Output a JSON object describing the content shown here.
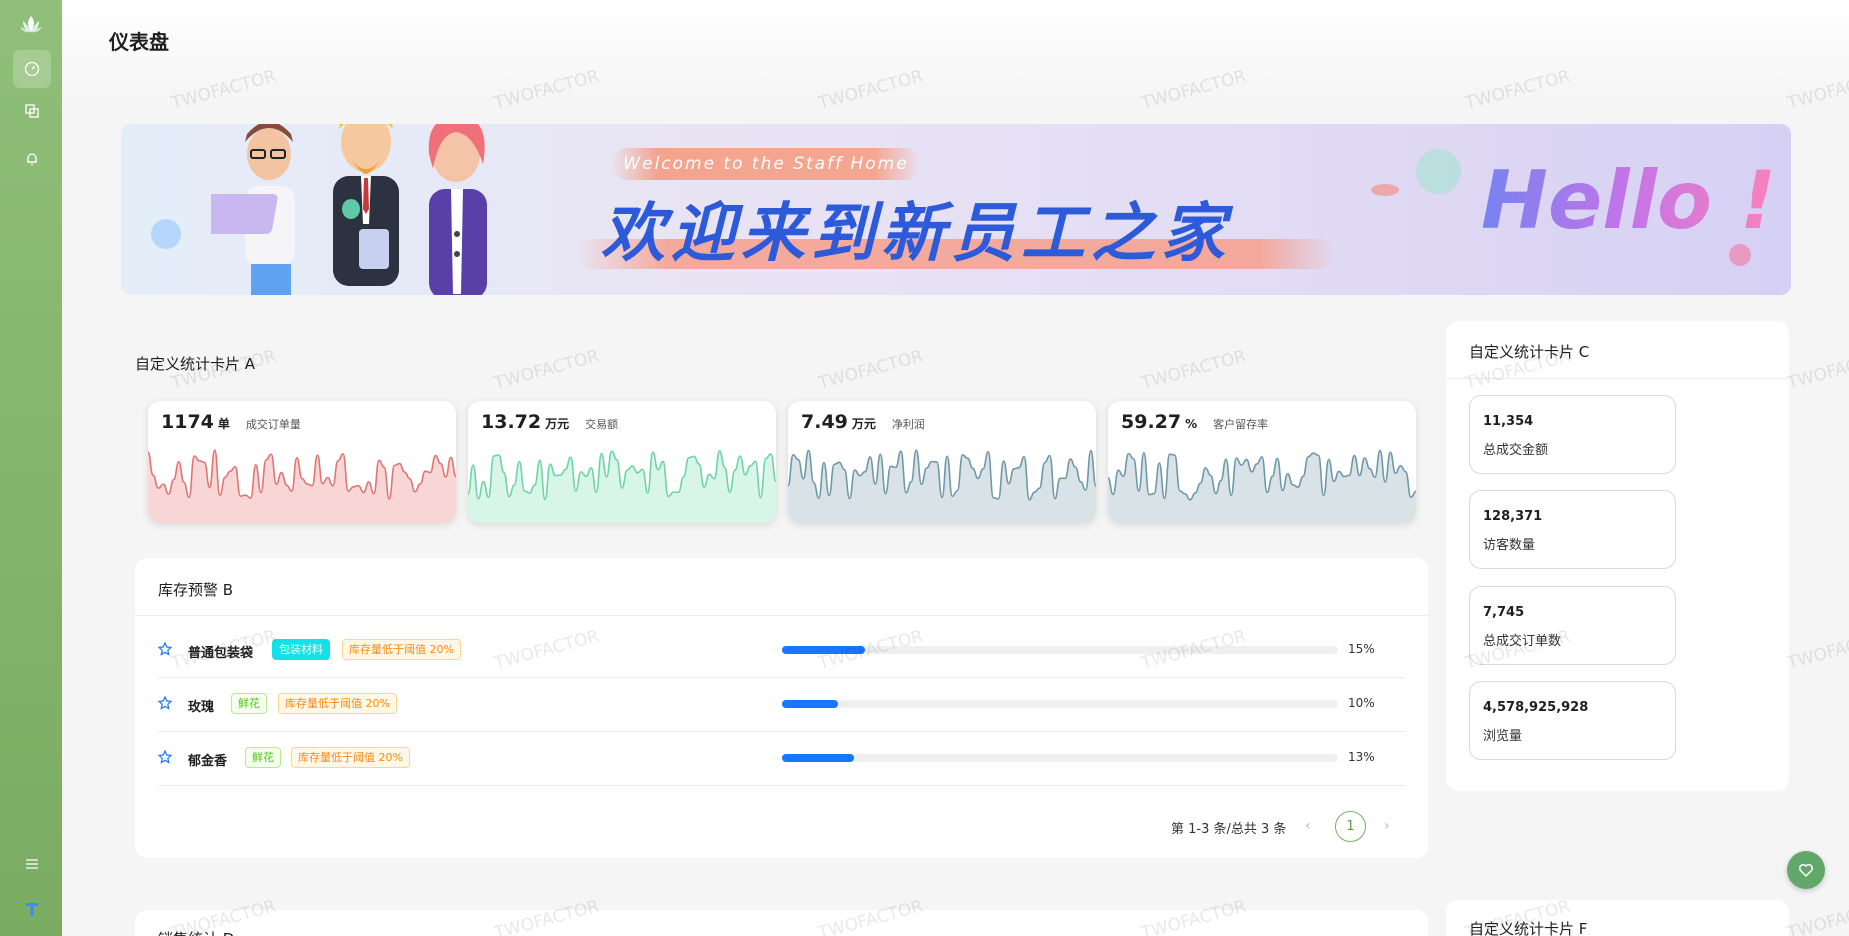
{
  "header": {
    "title": "仪表盘"
  },
  "banner": {
    "welcome": "Welcome to the Staff Home",
    "title": "欢迎来到新员工之家",
    "hello": "Hello !"
  },
  "card_a": {
    "title": "自定义统计卡片 A",
    "stats": [
      {
        "value": "1174",
        "unit": "单",
        "label": "成交订单量",
        "color": "#e07575",
        "fill": "#f8d6d6"
      },
      {
        "value": "13.72",
        "unit": "万元",
        "label": "交易额",
        "color": "#6fd3a6",
        "fill": "#d8f6e8"
      },
      {
        "value": "7.49",
        "unit": "万元",
        "label": "净利润",
        "color": "#6f98a8",
        "fill": "#d9e3e7"
      },
      {
        "value": "59.27",
        "unit": "%",
        "label": "客户留存率",
        "color": "#6f98a8",
        "fill": "#d9e3e7"
      }
    ]
  },
  "card_b": {
    "title": "库存预警 B",
    "rows": [
      {
        "name": "普通包装袋",
        "tag1": "包装材料",
        "tag2": "库存量低于阈值 20%",
        "percent": 15,
        "percent_label": "15%"
      },
      {
        "name": "玫瑰",
        "tag1": "鲜花",
        "tag2": "库存量低于阈值 20%",
        "percent": 10,
        "percent_label": "10%"
      },
      {
        "name": "郁金香",
        "tag1": "鲜花",
        "tag2": "库存量低于阈值 20%",
        "percent": 13,
        "percent_label": "13%"
      }
    ],
    "pager": {
      "summary": "第 1-3 条/总共 3 条",
      "prev": "‹",
      "page": "1",
      "next": "›"
    }
  },
  "card_c": {
    "title": "自定义统计卡片 C",
    "tiles": [
      {
        "value": "11,354",
        "label": "总成交金额"
      },
      {
        "value": "128,371",
        "label": "访客数量"
      },
      {
        "value": "7,745",
        "label": "总成交订单数"
      },
      {
        "value": "4,578,925,928",
        "label": "浏览量"
      }
    ]
  },
  "card_d": {
    "title": "销售统计 D"
  },
  "card_f": {
    "title": "自定义统计卡片 F"
  },
  "watermark": "TWOFACTOR",
  "colors": {
    "sidebar": "#85b66d",
    "accent": "#1677ff",
    "fab": "#62a86a"
  }
}
